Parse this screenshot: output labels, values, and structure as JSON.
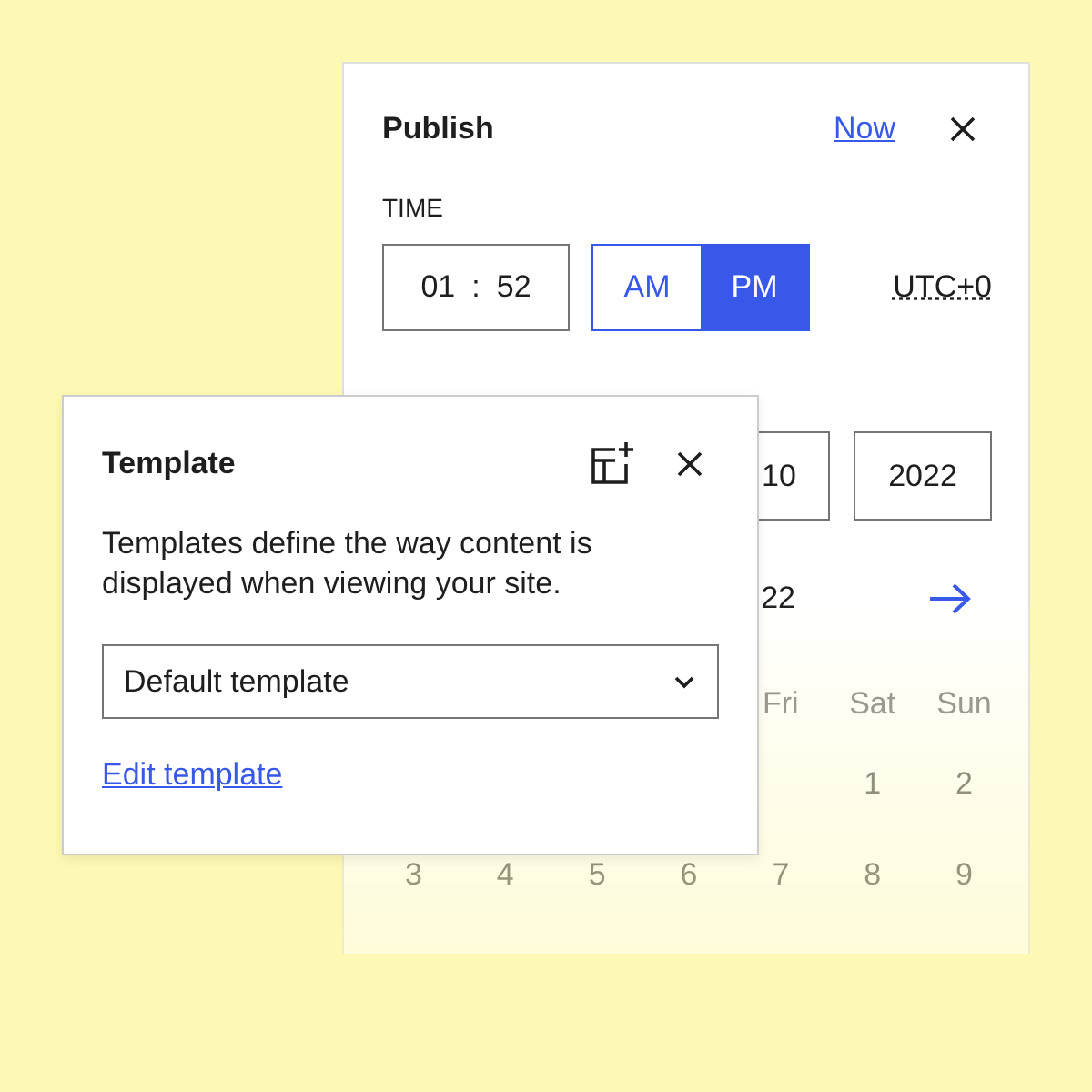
{
  "publish": {
    "title": "Publish",
    "now_link": "Now",
    "time_label": "TIME",
    "hours": "01",
    "separator": ":",
    "minutes": "52",
    "periods": [
      {
        "label": "AM",
        "selected": false
      },
      {
        "label": "PM",
        "selected": true
      }
    ],
    "timezone": "UTC+0",
    "day": "10",
    "year": "2022",
    "month_heading": "22",
    "weekdays": [
      "Fri",
      "Sat",
      "Sun"
    ],
    "weeks": [
      [
        "1",
        "2"
      ],
      [
        "3",
        "4",
        "5",
        "6",
        "7",
        "8",
        "9"
      ]
    ]
  },
  "template": {
    "title": "Template",
    "description": "Templates define the way content is displayed when viewing your site.",
    "select_value": "Default template",
    "edit_link": "Edit template"
  }
}
